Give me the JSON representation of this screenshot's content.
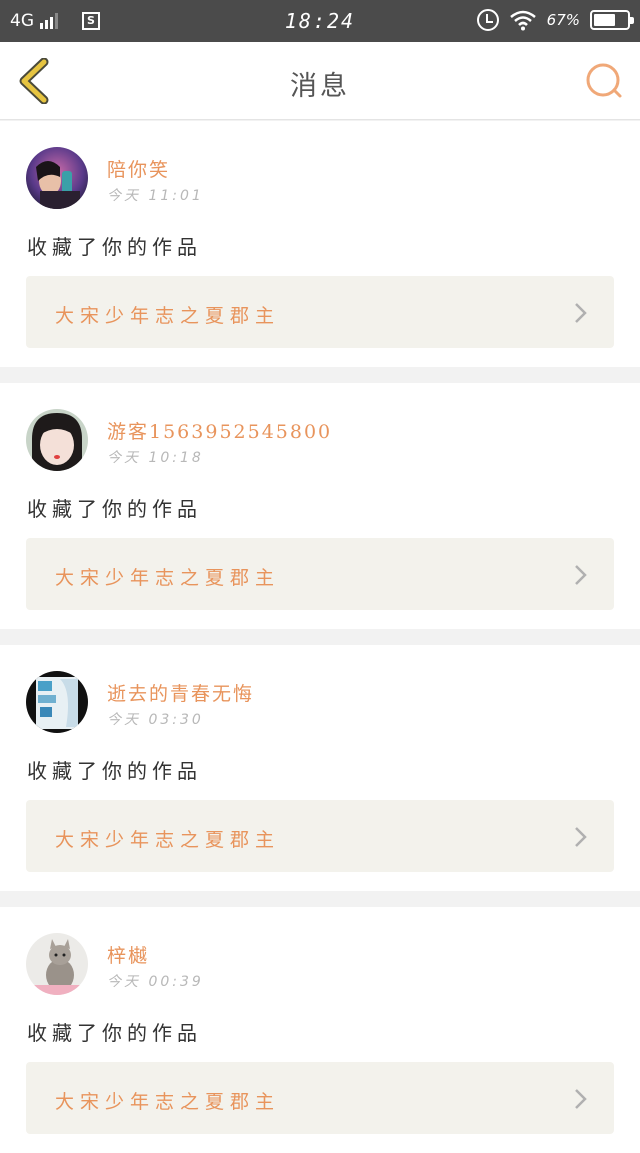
{
  "status_bar": {
    "network": "4G",
    "time": "18:24",
    "battery": "67%",
    "battery_level": 0.67
  },
  "header": {
    "title": "消息"
  },
  "messages": [
    {
      "username": "陪你笑",
      "time": "今天 11:01",
      "action": "收藏了你的作品",
      "work_title": "大宋少年志之夏郡主"
    },
    {
      "username": "游客1563952545800",
      "time": "今天 10:18",
      "action": "收藏了你的作品",
      "work_title": "大宋少年志之夏郡主"
    },
    {
      "username": "逝去的青春无悔",
      "time": "今天 03:30",
      "action": "收藏了你的作品",
      "work_title": "大宋少年志之夏郡主"
    },
    {
      "username": "梓樾",
      "time": "今天 00:39",
      "action": "收藏了你的作品",
      "work_title": "大宋少年志之夏郡主"
    }
  ],
  "colors": {
    "accent": "#e8945c",
    "back_icon": "#e6b840",
    "status_bar": "#4b4b4b"
  }
}
